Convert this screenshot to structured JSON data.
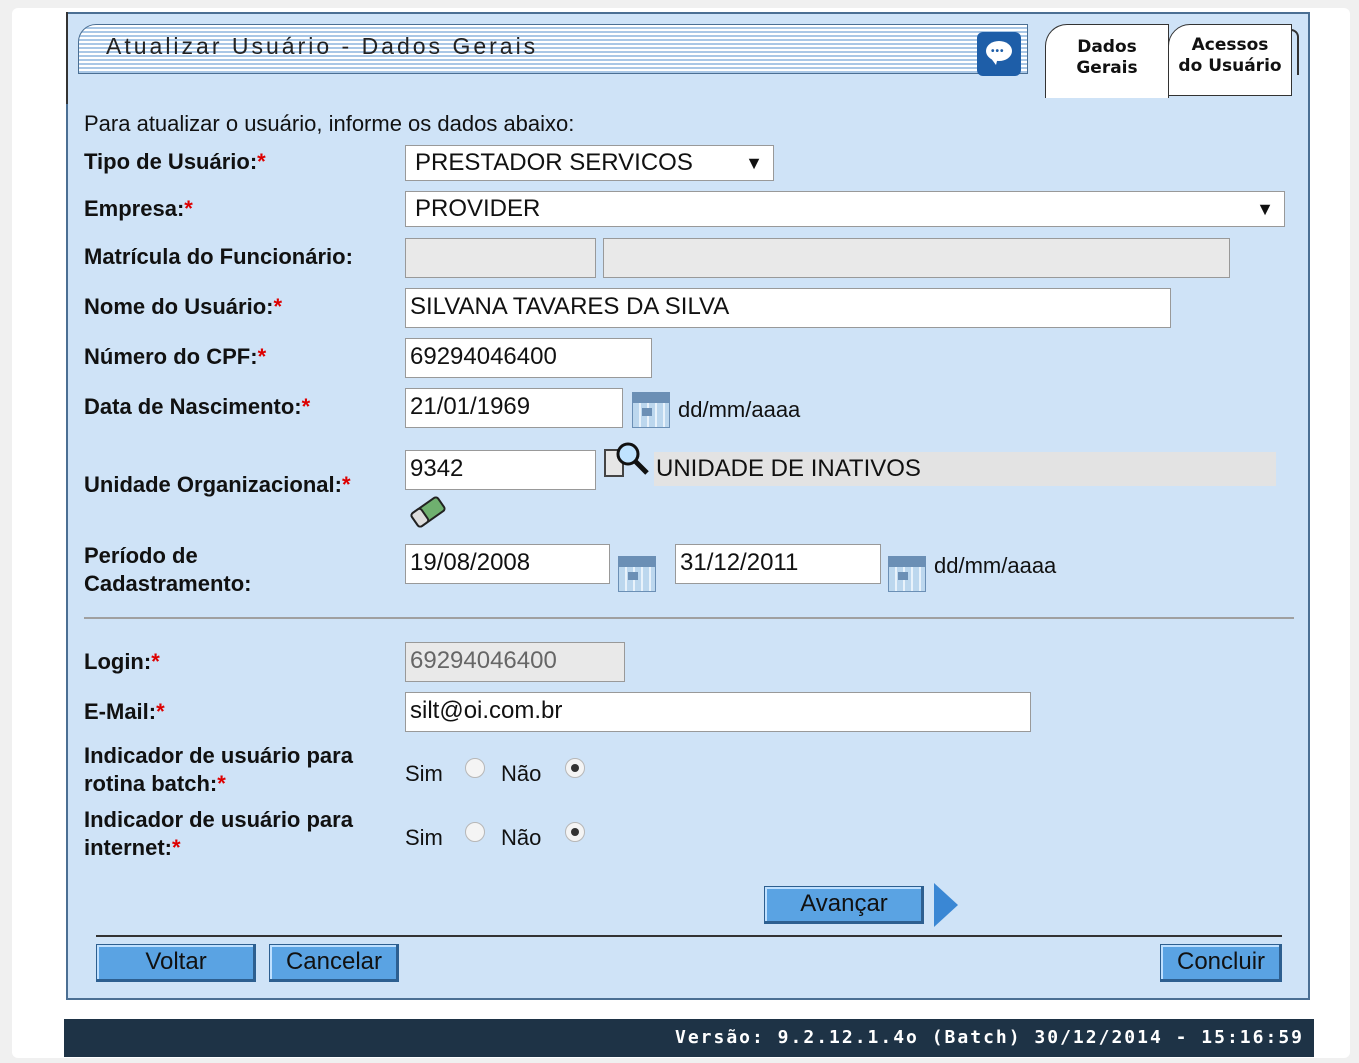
{
  "header": {
    "title": "Atualizar Usuário - Dados Gerais",
    "tabs": [
      {
        "line1": "Dados",
        "line2": "Gerais"
      },
      {
        "line1": "Acessos",
        "line2": "do Usuário"
      }
    ]
  },
  "form": {
    "intro": "Para atualizar o usuário, informe os dados abaixo:",
    "tipo_label": "Tipo de Usuário:",
    "tipo_value": "PRESTADOR SERVICOS",
    "empresa_label": "Empresa:",
    "empresa_value": "PROVIDER",
    "matricula_label": "Matrícula do Funcionário:",
    "matricula_value1": "",
    "matricula_value2": "",
    "nome_label": "Nome do Usuário:",
    "nome_value": "SILVANA TAVARES DA SILVA",
    "cpf_label": "Número do CPF:",
    "cpf_value": "69294046400",
    "nascimento_label": "Data de Nascimento:",
    "nascimento_value": "21/01/1969",
    "date_format": "dd/mm/aaaa",
    "unidade_label": "Unidade Organizacional:",
    "unidade_code": "9342",
    "unidade_desc": "UNIDADE DE INATIVOS",
    "periodo_label1": "Período de",
    "periodo_label2": "Cadastramento:",
    "periodo_inicio": "19/08/2008",
    "periodo_fim": "31/12/2011",
    "login_label": "Login:",
    "login_value": "69294046400",
    "email_label": "E-Mail:",
    "email_value": "silt@oi.com.br",
    "batch_label1": "Indicador de usuário para",
    "batch_label2": "rotina batch:",
    "internet_label1": "Indicador de usuário para",
    "internet_label2": "internet:",
    "sim": "Sim",
    "nao": "Não",
    "required_mark": "*",
    "batch_selected": "Não",
    "internet_selected": "Não"
  },
  "buttons": {
    "avancar": "Avançar",
    "voltar": "Voltar",
    "cancelar": "Cancelar",
    "concluir": "Concluir"
  },
  "footer": {
    "version": "Versão: 9.2.12.1.4o (Batch) 30/12/2014 - 15:16:59"
  },
  "colors": {
    "panel_bg": "#cfe3f7",
    "button_bg": "#5aa3e3",
    "footer_bg": "#1e3346",
    "required": "#dd0000"
  }
}
